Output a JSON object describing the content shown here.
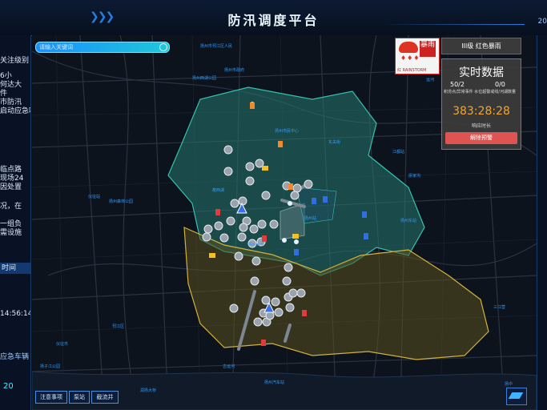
{
  "header": {
    "title": "防汛调度平台",
    "right_text": "20"
  },
  "search": {
    "placeholder": "请输入关键词"
  },
  "left_panel": {
    "lines": [
      "关注级别",
      "6小",
      "何达大",
      "件",
      "市防汛",
      "启动应急响",
      "",
      "",
      "临点路",
      "现场24",
      "因处置",
      "",
      "",
      "况，在",
      "",
      "一组负",
      "需设施"
    ],
    "time_label": "时间",
    "timestamp": "14:56:14",
    "car_label": "应急车辆",
    "car_count": "20"
  },
  "alert": {
    "zh": "暴雨",
    "en": "RAINSTORM",
    "prefix": "红"
  },
  "level": {
    "label": "III级 红色暴雨"
  },
  "realtime": {
    "title": "实时数据",
    "stat_a": "50/2",
    "stat_b": "0/0",
    "caption": "积涝点/异常事件 水位超警戒线/河湖数量",
    "timer": "383:28:28",
    "duration_label": "响应时长",
    "release_button": "解除预警"
  },
  "bottom_buttons": {
    "notes": "注意事项",
    "pump": "泵站",
    "gate": "截流井"
  },
  "layer_toggle": "图层",
  "map_labels": [
    "扬州市邗江区人民",
    "扬州西湖公园",
    "扬州市政府",
    "扬州市民中心",
    "扬州大学",
    "瘦西湖",
    "东关街",
    "江都站",
    "扬州站",
    "廖家沟",
    "扬州东站",
    "运河",
    "宝应湖公园",
    "仪征市",
    "扬子江公园",
    "古运河",
    "三江营",
    "扬中",
    "润扬大桥",
    "扬州汽车站",
    "仪征站",
    "邗江区",
    "扬州森林公园"
  ]
}
